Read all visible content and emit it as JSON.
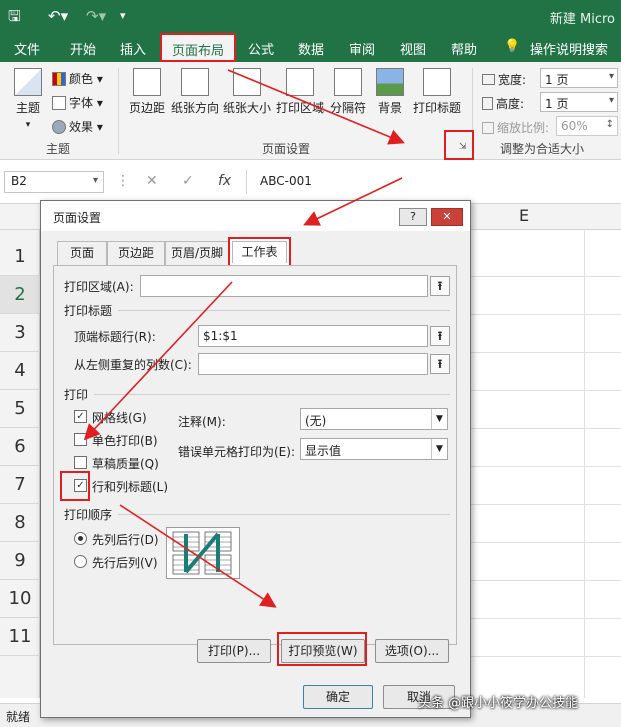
{
  "titlebar": {
    "app_title": "新建 Micro",
    "qat": [
      "save-icon",
      "undo-icon",
      "redo-icon",
      "customize-icon"
    ]
  },
  "menu_tabs": [
    "文件",
    "开始",
    "插入",
    "页面布局",
    "公式",
    "数据",
    "审阅",
    "视图",
    "帮助",
    "操作说明搜索"
  ],
  "ribbon": {
    "theme_group": {
      "label": "主题",
      "themes_button": "主题",
      "colors": "颜色",
      "fonts": "字体",
      "effects": "效果"
    },
    "page_setup_group": {
      "label": "页面设置",
      "buttons": [
        "页边距",
        "纸张方向",
        "纸张大小",
        "打印区域",
        "分隔符",
        "背景",
        "打印标题"
      ]
    },
    "scale_group": {
      "label": "调整为合适大小",
      "width_label": "宽度:",
      "width_value": "1 页",
      "height_label": "高度:",
      "height_value": "1 页",
      "scale_label": "缩放比例:",
      "scale_value": "60%"
    }
  },
  "formula_bar": {
    "cell_ref": "B2",
    "fx": "fx",
    "value": "ABC-001"
  },
  "sheet": {
    "visible_column": "E",
    "rows": [
      "1",
      "2",
      "3",
      "4",
      "5",
      "6",
      "7",
      "8",
      "9",
      "10",
      "11"
    ]
  },
  "dialog": {
    "title": "页面设置",
    "help": "?",
    "close": "✕",
    "tabs": [
      "页面",
      "页边距",
      "页眉/页脚",
      "工作表"
    ],
    "active_tab": "工作表",
    "print_area_label": "打印区域(A):",
    "print_area_value": "",
    "print_titles_label": "打印标题",
    "rows_to_repeat_label": "顶端标题行(R):",
    "rows_to_repeat_value": "$1:$1",
    "cols_to_repeat_label": "从左侧重复的列数(C):",
    "cols_to_repeat_value": "",
    "print_section_label": "打印",
    "gridlines_label": "网格线(G)",
    "gridlines_checked": true,
    "black_white_label": "单色打印(B)",
    "black_white_checked": false,
    "draft_label": "草稿质量(Q)",
    "draft_checked": false,
    "headings_label": "行和列标题(L)",
    "headings_checked": true,
    "comments_label": "注释(M):",
    "comments_value": "(无)",
    "errors_label": "错误单元格打印为(E):",
    "errors_value": "显示值",
    "order_label": "打印顺序",
    "down_then_over_label": "先列后行(D)",
    "down_then_over_selected": true,
    "over_then_down_label": "先行后列(V)",
    "over_then_down_selected": false,
    "print_button": "打印(P)...",
    "preview_button": "打印预览(W)",
    "options_button": "选项(O)...",
    "ok_button": "确定",
    "cancel_button": "取消"
  },
  "statusbar": {
    "status": "就绪"
  },
  "watermark": "头条 @跟小小筱学办公技能",
  "colors": {
    "excel_green": "#217346",
    "highlight_red": "#e02020"
  }
}
